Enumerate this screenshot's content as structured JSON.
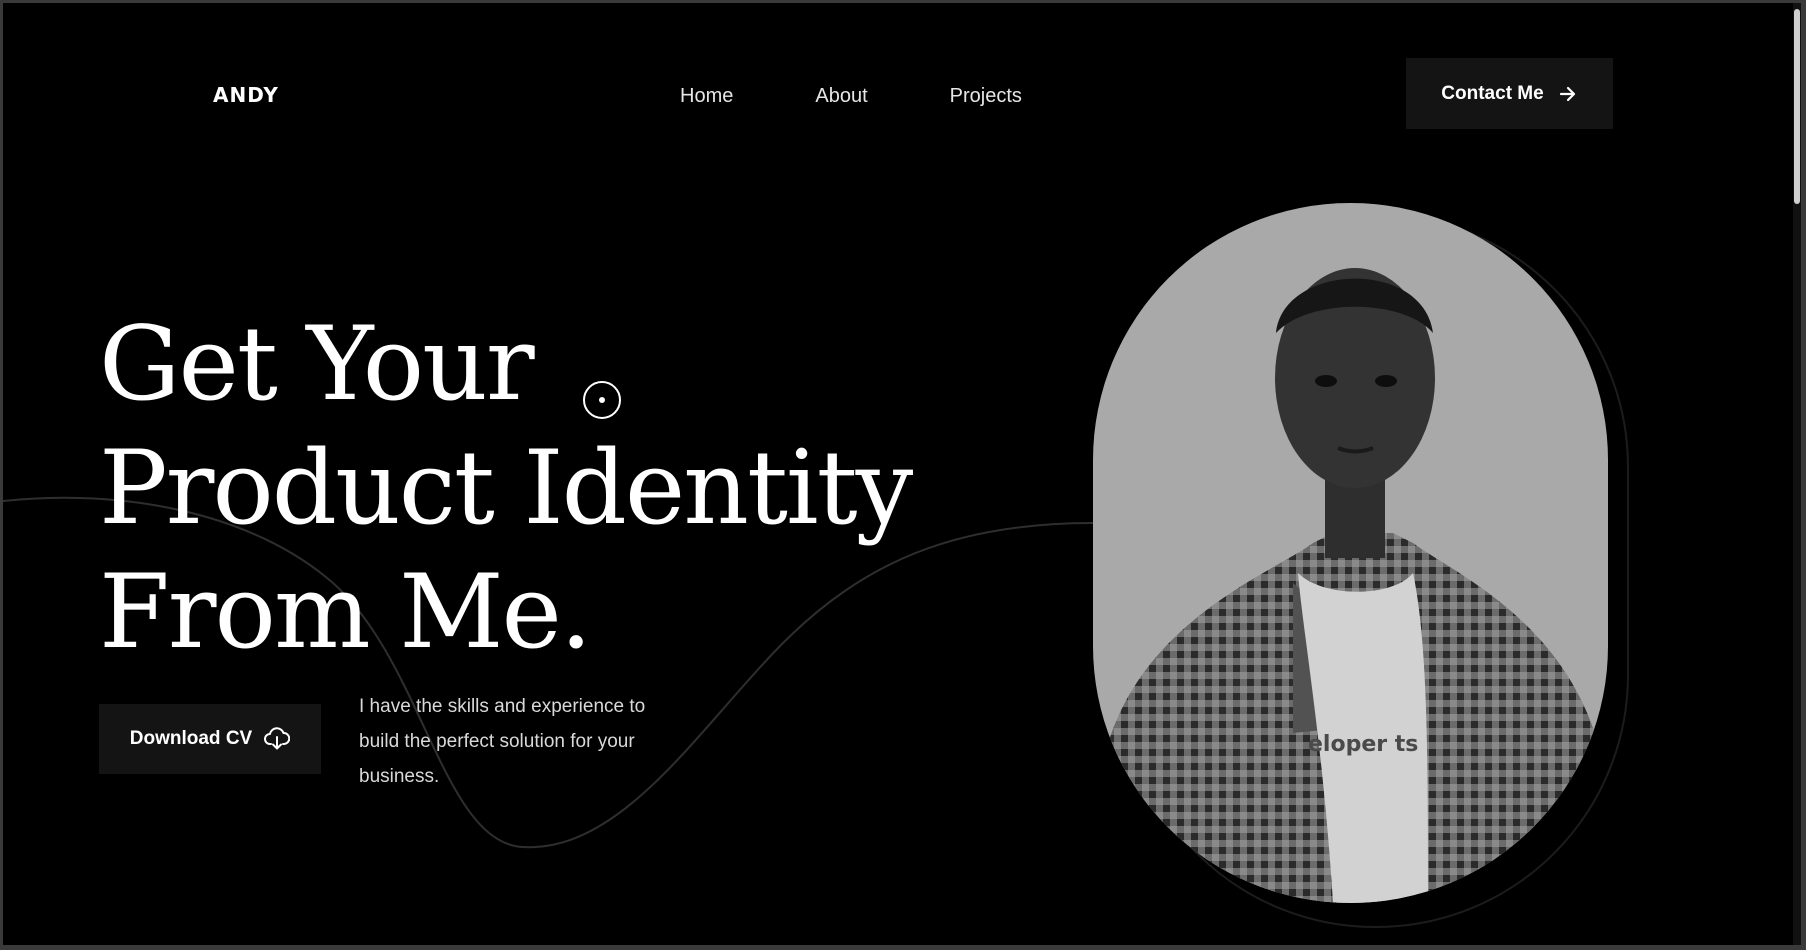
{
  "brand": {
    "logo": "ANDY"
  },
  "nav": {
    "items": [
      "Home",
      "About",
      "Projects"
    ]
  },
  "header": {
    "contact_label": "Contact Me",
    "contact_icon": "arrow-right-icon"
  },
  "hero": {
    "title_lines": [
      "Get Your",
      "Product Identity",
      "From Me."
    ],
    "download_label": "Download CV",
    "download_icon": "cloud-download-icon",
    "intro": "I have the skills and experience to build the perfect solution for your business.",
    "cursor_icon": "target-icon"
  },
  "portrait": {
    "shirt_text": "eloper ts",
    "image": "grayscale portrait photo"
  },
  "colors": {
    "background": "#000000",
    "button_bg": "#141414",
    "text": "#ffffff",
    "muted_text": "#d9d9d9",
    "curve": "#2e2e2e"
  }
}
